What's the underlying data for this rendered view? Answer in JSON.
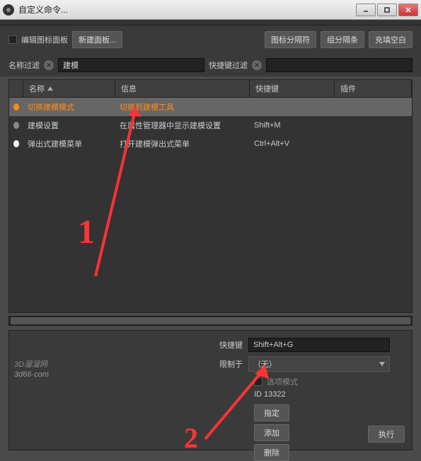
{
  "window": {
    "title": "自定义命令..."
  },
  "toolbar": {
    "edit_palette": "编辑图标面板",
    "new_palette": "新建面板...",
    "icon_sep": "图标分隔符",
    "group_sep": "组分隔条",
    "fill_blank": "充填空白"
  },
  "filters": {
    "name_label": "名称过滤",
    "name_value": "建模",
    "shortcut_label": "快捷键过滤",
    "shortcut_value": ""
  },
  "columns": {
    "name": "名称",
    "info": "信息",
    "shortcut": "快捷键",
    "plugin": "插件"
  },
  "rows": [
    {
      "name": "切换建模模式",
      "info": "切换到建模工具",
      "shortcut": ""
    },
    {
      "name": "建模设置",
      "info": "在属性管理器中显示建模设置",
      "shortcut": "Shift+M"
    },
    {
      "name": "弹出式建模菜单",
      "info": "打开建模弹出式菜单",
      "shortcut": "Ctrl+Alt+V"
    }
  ],
  "form": {
    "shortcut_label": "快捷键",
    "shortcut_value": "Shift+Alt+G",
    "restrict_label": "限制于",
    "restrict_value": "（无）",
    "option_mode": "选项模式",
    "id_label": "ID 13322",
    "assign": "指定",
    "add": "添加",
    "delete": "删除",
    "execute": "执行"
  },
  "watermark": {
    "line1": "3D溜溜网",
    "line2": "3d66·com"
  },
  "annotations": {
    "n1": "1",
    "n2": "2"
  }
}
